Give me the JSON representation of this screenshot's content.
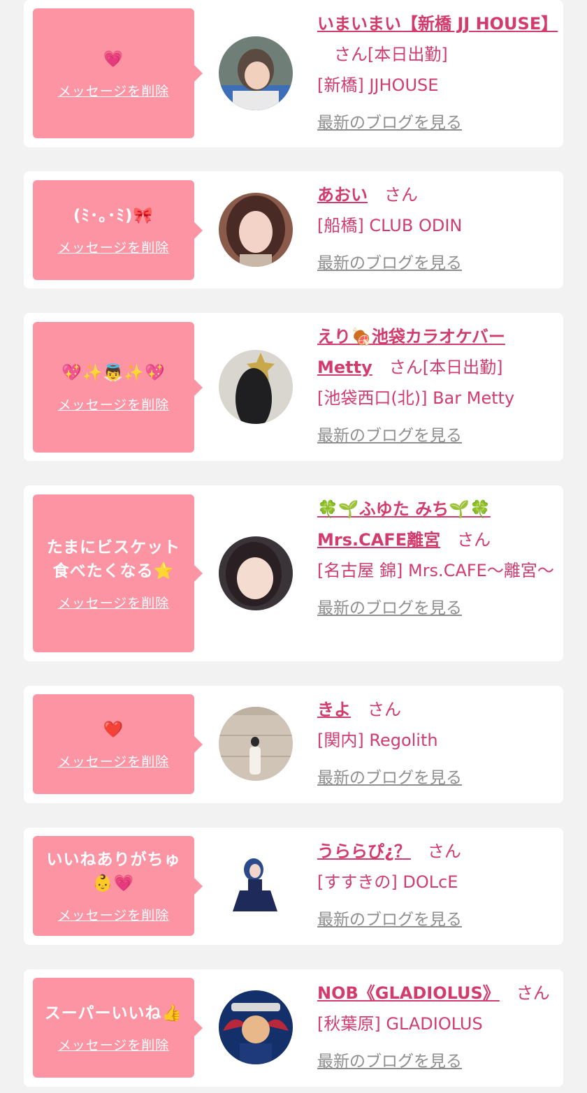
{
  "delete_label": "メッセージを削除",
  "blog_label": "最新のブログを見る",
  "san_label": "さん",
  "colors": {
    "background": "#f2f2f2",
    "bubble": "#fd94a4",
    "accent": "#d23c6c",
    "link_gray": "#8e8e8e"
  },
  "items": [
    {
      "message": "💗",
      "name": "いまいまい【新橋 JJ HOUSE】",
      "status": "[本日出勤]",
      "shop": "[新橋] JJHOUSE",
      "avatar_icon": "profile-photo-short-hair"
    },
    {
      "message": "(ﾐ･｡･ﾐ)🎀",
      "name": "あおい",
      "status": "",
      "shop": "[船橋] CLUB ODIN",
      "avatar_icon": "profile-photo-selfie"
    },
    {
      "message": "💖✨👼✨💖",
      "name": "えり🍖池袋カラオケバーMetty",
      "status": "[本日出勤]",
      "shop": "[池袋西口(北)] Bar Metty",
      "avatar_icon": "profile-photo-long-hair"
    },
    {
      "message": "たまにビスケット\n食べたくなる⭐",
      "name": "🍀🌱ふゆた みち🌱🍀Mrs.CAFE離宮",
      "status": "",
      "shop": "[名古屋 錦] Mrs.CAFE〜離宮〜",
      "avatar_icon": "profile-photo-smiling"
    },
    {
      "message": "❤️",
      "name": "きよ",
      "status": "",
      "shop": "[関内] Regolith",
      "avatar_icon": "profile-photo-full-body"
    },
    {
      "message": "いいねありがちゅ\n👶💗",
      "name": "うららぴ¿？",
      "status": "",
      "shop": "[すすきの] DOLcE",
      "avatar_icon": "profile-photo-cosplay"
    },
    {
      "message": "スーパーいいね👍",
      "name": "NOB《GLADIOLUS》",
      "status": "",
      "shop": "[秋葉原] GLADIOLUS",
      "avatar_icon": "profile-illustration-red-wings"
    }
  ]
}
